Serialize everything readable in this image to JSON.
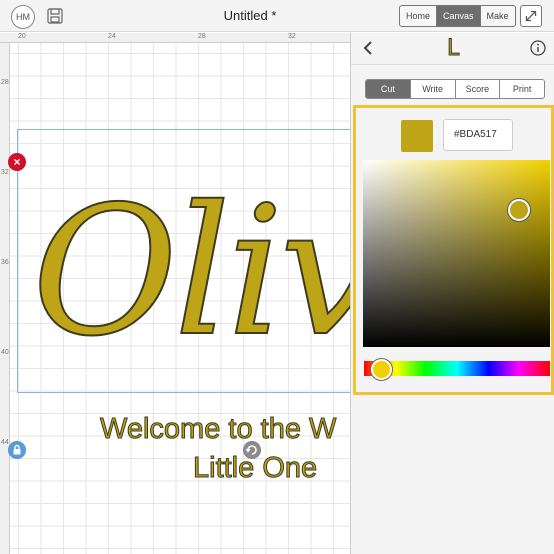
{
  "header": {
    "avatar_initials": "HM",
    "title": "Untitled *",
    "nav": [
      {
        "label": "Home",
        "active": false
      },
      {
        "label": "Canvas",
        "active": true
      },
      {
        "label": "Make",
        "active": false
      }
    ]
  },
  "rulers": {
    "top_ticks": [
      "20",
      "24",
      "28",
      "32"
    ],
    "left_ticks": [
      "28",
      "32",
      "36",
      "40",
      "44"
    ]
  },
  "design": {
    "script_text": "Oliv",
    "line1": "Welcome to the W",
    "line2": "Little One",
    "delete_icon": "×"
  },
  "panel": {
    "layer_glyph": "L",
    "tabs": [
      "Cut",
      "Write",
      "Score",
      "Print"
    ],
    "active_tab": "Cut",
    "color_hex": "#BDA517"
  },
  "colors": {
    "selected": "#BDA517",
    "outline": "#3e3a20",
    "hue_base": "#f2d000",
    "picker_border": "#f1c232",
    "delete": "#d0112b",
    "lock": "#5b9bd5",
    "rotate": "#8b8b8b"
  },
  "icons": [
    "save-icon",
    "expand-icon",
    "back-chevron-icon",
    "info-icon",
    "close-icon",
    "lock-icon",
    "rotate-icon"
  ]
}
